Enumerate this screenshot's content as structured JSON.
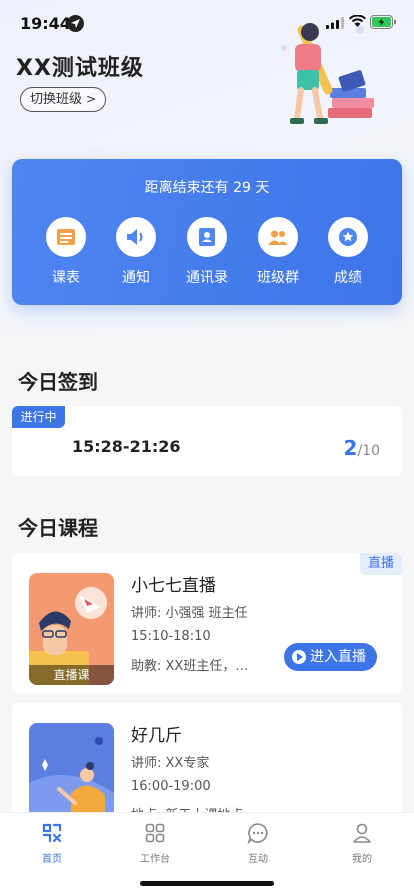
{
  "status_bar": {
    "time": "19:44"
  },
  "header": {
    "class_name": "XX测试班级",
    "switch_label": "切换班级"
  },
  "countdown": {
    "text": "距离结束还有 29 天",
    "quick_actions": [
      {
        "label": "课表",
        "icon": "schedule-icon"
      },
      {
        "label": "通知",
        "icon": "speaker-icon"
      },
      {
        "label": "通讯录",
        "icon": "contacts-icon"
      },
      {
        "label": "班级群",
        "icon": "group-icon"
      },
      {
        "label": "成绩",
        "icon": "grade-star-icon"
      }
    ]
  },
  "checkin": {
    "section_title": "今日签到",
    "status": "进行中",
    "time_range": "15:28-21:26",
    "done": "2",
    "total": "/10"
  },
  "courses": {
    "section_title": "今日课程",
    "items": [
      {
        "name": "小七七直播",
        "teacher": "讲师: 小强强 班主任",
        "time": "15:10-18:10",
        "assistant": "助教: XX班主任，…",
        "thumb_tag": "直播课",
        "badge": "直播",
        "action": "进入直播"
      },
      {
        "name": "好几斤",
        "teacher": "讲师: XX专家",
        "time": "16:00-19:00",
        "location": "地点: 新天上课地点"
      }
    ]
  },
  "tabbar": {
    "tabs": [
      {
        "label": "首页",
        "icon": "home-icon",
        "active": true
      },
      {
        "label": "工作台",
        "icon": "workbench-icon"
      },
      {
        "label": "互动",
        "icon": "chat-icon"
      },
      {
        "label": "我的",
        "icon": "profile-icon"
      }
    ]
  },
  "colors": {
    "primary": "#3d74e8",
    "background": "#f5f6f8",
    "icon_orange": "#f0a04b"
  }
}
